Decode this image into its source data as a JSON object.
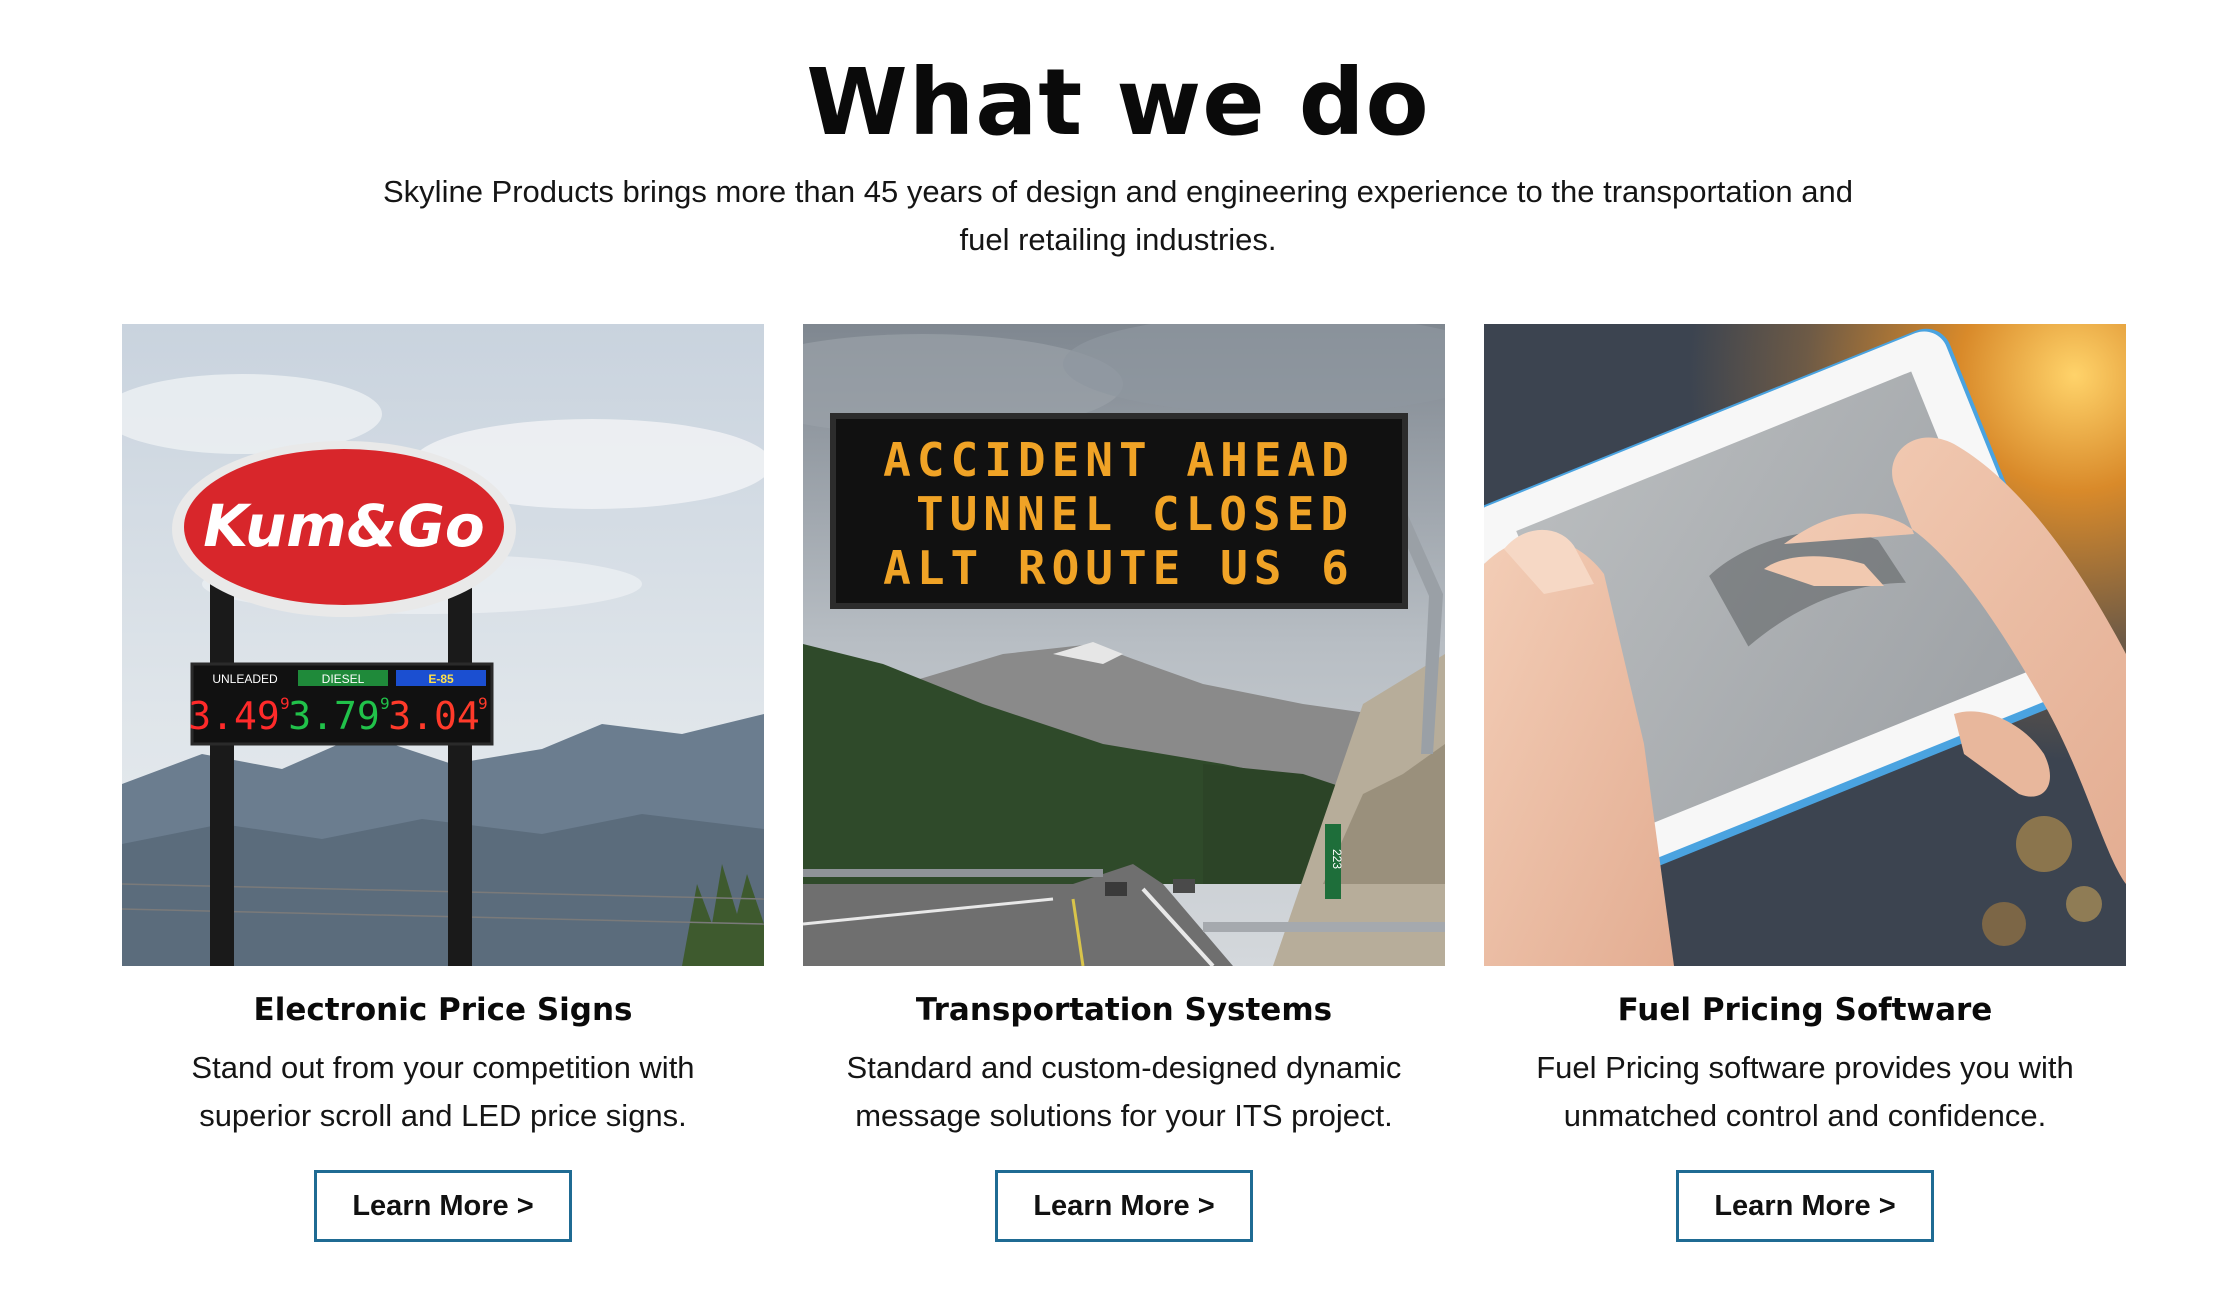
{
  "header": {
    "title": "What we do",
    "intro": "Skyline Products brings more than 45 years of design and engineering experience to the transportation and fuel retailing industries."
  },
  "cards": [
    {
      "title": "Electronic Price Signs",
      "text": "Stand out from your competition with superior scroll and LED price signs.",
      "button": "Learn More >",
      "image": {
        "logo_text": "Kum&Go",
        "grades": [
          "UNLEADED",
          "DIESEL",
          "E-85"
        ],
        "prices": [
          "3.49",
          "3.79",
          "3.04"
        ],
        "price_suffix": "9",
        "grade_colors": [
          "#ffffff",
          "#1f8a3a",
          "#1b4fd1"
        ],
        "price_colors": [
          "#ff2a2a",
          "#21c24a",
          "#ff3a2a"
        ]
      }
    },
    {
      "title": "Transportation Systems",
      "text": "Standard and custom-designed dynamic message solutions for your ITS project.",
      "button": "Learn More >",
      "image": {
        "sign_lines": [
          "ACCIDENT AHEAD",
          "TUNNEL CLOSED",
          "ALT ROUTE US 6"
        ],
        "sign_color": "#f0a326",
        "mile_marker": "223"
      }
    },
    {
      "title": "Fuel Pricing Software",
      "text": "Fuel Pricing software provides you with unmatched control and confidence.",
      "button": "Learn More >",
      "image": {
        "subject": "hands-holding-tablet"
      }
    }
  ],
  "colors": {
    "button_border": "#1f6b93",
    "text": "#111111"
  }
}
